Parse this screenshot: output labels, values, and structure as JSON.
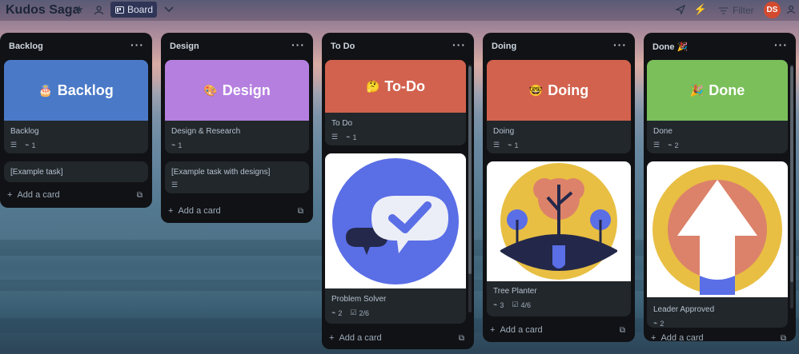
{
  "app": {
    "title": "Kudos Saga"
  },
  "header": {
    "board_label": "Board",
    "filter_label": "Filter",
    "avatar_initials": "DS"
  },
  "lists": [
    {
      "title": "Backlog",
      "cards": [
        {
          "cover_text": "Backlog",
          "cover_emoji": "🎂",
          "cover_color": "#4a79c7",
          "title": "Backlog",
          "attachments": "1",
          "has_description": true
        },
        {
          "title": "[Example task]"
        }
      ],
      "add_label": "Add a card"
    },
    {
      "title": "Design",
      "cards": [
        {
          "cover_text": "Design",
          "cover_emoji": "🎨",
          "cover_color": "#b57fe0",
          "title": "Design & Research",
          "attachments": "1"
        },
        {
          "title": "[Example task with designs]",
          "has_description": true
        }
      ],
      "add_label": "Add a card"
    },
    {
      "title": "To Do",
      "cards": [
        {
          "cover_text": "To-Do",
          "cover_emoji": "🤔",
          "cover_color": "#d2624e",
          "title": "To Do",
          "attachments": "1",
          "has_description": true
        },
        {
          "title": "Problem Solver",
          "attachments": "2",
          "checklist": "2/6"
        }
      ],
      "add_label": "Add a card"
    },
    {
      "title": "Doing",
      "cards": [
        {
          "cover_text": "Doing",
          "cover_emoji": "🤓",
          "cover_color": "#d2624e",
          "title": "Doing",
          "attachments": "1",
          "has_description": true
        },
        {
          "title": "Tree Planter",
          "attachments": "3",
          "checklist": "4/6"
        }
      ],
      "add_label": "Add a card"
    },
    {
      "title": "Done 🎉",
      "cards": [
        {
          "cover_text": "Done",
          "cover_emoji": "🎉",
          "cover_color": "#7abf5a",
          "title": "Done",
          "attachments": "2",
          "has_description": true
        },
        {
          "title": "Leader Approved",
          "attachments": "2"
        }
      ],
      "add_label": "Add a card"
    }
  ],
  "colors": {
    "list_bg": "#111215",
    "card_bg": "#22272b",
    "accent_board": "#2f3556",
    "avatar": "#d34a2f"
  }
}
